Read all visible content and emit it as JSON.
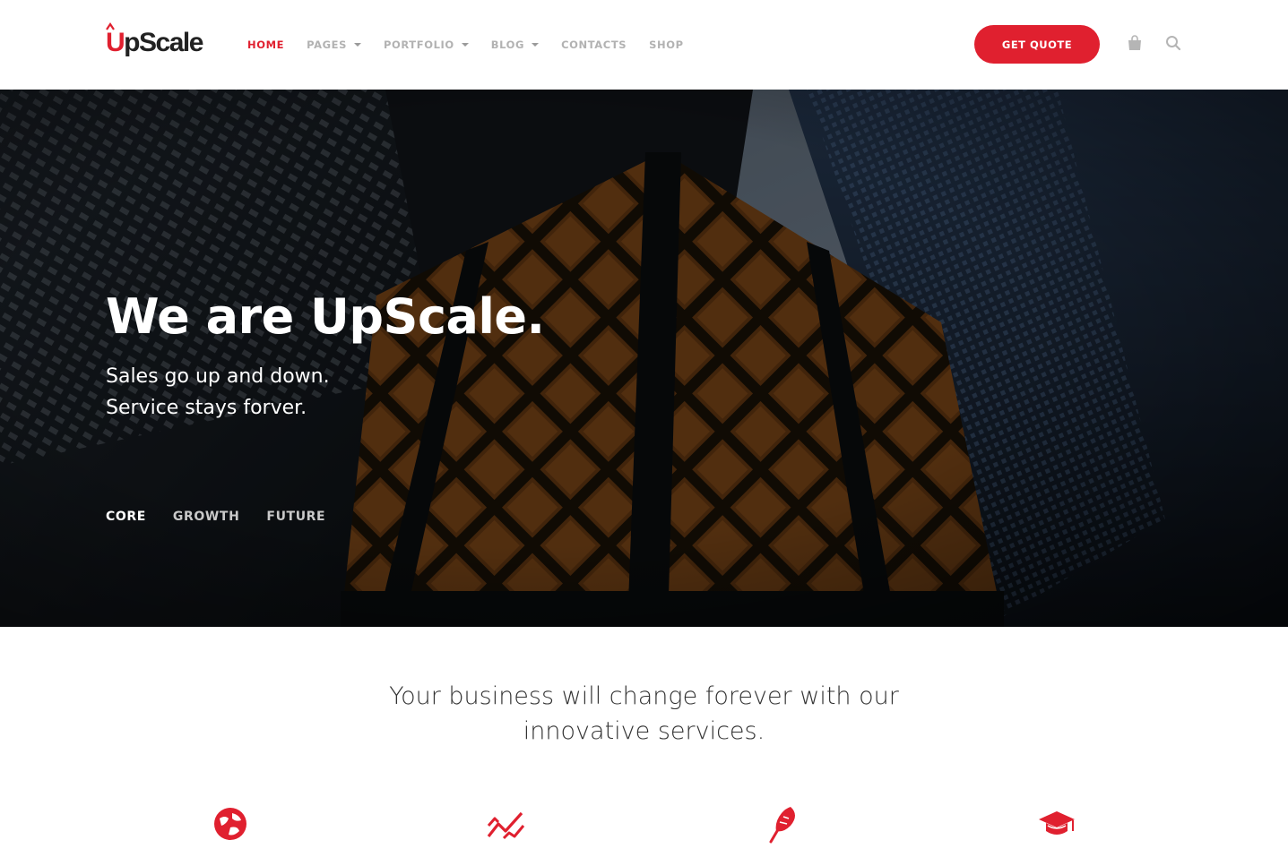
{
  "brand": {
    "name": "UpScale",
    "name_accent": "U",
    "name_rest": "pScale",
    "accent_color": "#e0202f"
  },
  "nav": {
    "items": [
      {
        "label": "HOME",
        "has_dropdown": false,
        "active": true
      },
      {
        "label": "PAGES",
        "has_dropdown": true,
        "active": false
      },
      {
        "label": "PORTFOLIO",
        "has_dropdown": true,
        "active": false
      },
      {
        "label": "BLOG",
        "has_dropdown": true,
        "active": false
      },
      {
        "label": "CONTACTS",
        "has_dropdown": false,
        "active": false
      },
      {
        "label": "SHOP",
        "has_dropdown": false,
        "active": false
      }
    ],
    "cta_label": "GET QUOTE",
    "icons": [
      "shopping-bag-icon",
      "search-icon"
    ]
  },
  "hero": {
    "title": "We are UpScale.",
    "subtitle_line1": "Sales go up and down.",
    "subtitle_line2": "Service stays forver.",
    "tabs": [
      {
        "label": "CORE",
        "active": true
      },
      {
        "label": "GROWTH",
        "active": false
      },
      {
        "label": "FUTURE",
        "active": false
      }
    ]
  },
  "intro": {
    "line1": "Your business will change forever with our",
    "line2": "innovative services."
  },
  "services": {
    "icons": [
      "globe-icon",
      "trend-chart-icon",
      "feather-icon",
      "graduation-cap-icon"
    ]
  }
}
